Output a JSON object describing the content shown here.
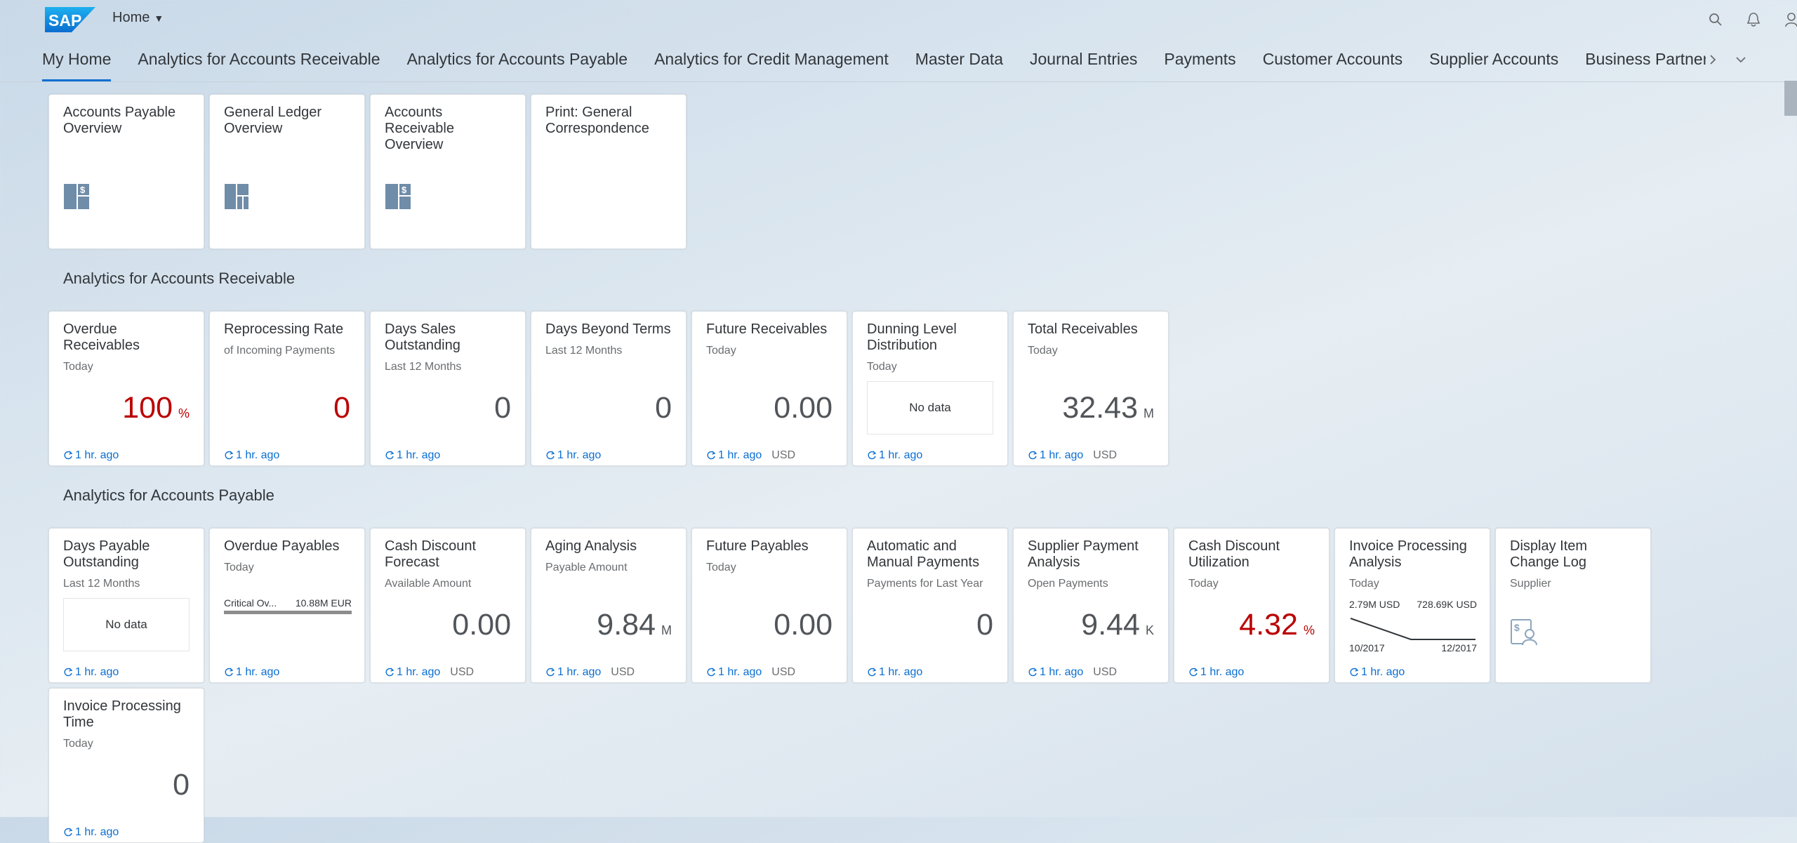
{
  "shell": {
    "logo_text": "SAP",
    "home_label": "Home",
    "brand_color": "#0a6ed1",
    "icons": [
      "search-icon",
      "bell-icon",
      "user-icon"
    ]
  },
  "tabs": [
    {
      "label": "My Home",
      "active": true
    },
    {
      "label": "Analytics for Accounts Receivable"
    },
    {
      "label": "Analytics for Accounts Payable"
    },
    {
      "label": "Analytics for Credit Management"
    },
    {
      "label": "Master Data"
    },
    {
      "label": "Journal Entries"
    },
    {
      "label": "Payments"
    },
    {
      "label": "Customer Accounts"
    },
    {
      "label": "Supplier Accounts"
    },
    {
      "label": "Business Partner Ma"
    }
  ],
  "my_home": {
    "tiles": [
      {
        "title": "Accounts Payable Overview",
        "icon": "overview-page-icon"
      },
      {
        "title": "General Ledger Overview",
        "icon": "overview-page-icon"
      },
      {
        "title": "Accounts Receivable Overview",
        "icon": "overview-page-icon"
      },
      {
        "title": "Print: General Correspondence"
      }
    ]
  },
  "ar": {
    "title": "Analytics for Accounts Receivable",
    "tiles": [
      {
        "title": "Overdue Receivables",
        "sub": "Today",
        "value": "100",
        "scale": "%",
        "refresh": "1 hr. ago",
        "unit": ""
      },
      {
        "title": "Reprocessing Rate",
        "sub": "of Incoming Payments",
        "value": "0",
        "scale": "",
        "refresh": "1 hr. ago",
        "unit": ""
      },
      {
        "title": "Days Sales Outstanding",
        "sub": "Last 12 Months",
        "value": "0",
        "scale": "",
        "refresh": "1 hr. ago",
        "unit": ""
      },
      {
        "title": "Days Beyond Terms",
        "sub": "Last 12 Months",
        "value": "0",
        "scale": "",
        "refresh": "1 hr. ago",
        "unit": ""
      },
      {
        "title": "Future Receivables",
        "sub": "Today",
        "value": "0.00",
        "scale": "",
        "refresh": "1 hr. ago",
        "unit": "USD"
      },
      {
        "title": "Dunning Level Distribution",
        "sub": "Today",
        "nodata": "No data",
        "refresh": "1 hr. ago",
        "unit": ""
      },
      {
        "title": "Total Receivables",
        "sub": "Today",
        "value": "32.43",
        "scale": "M",
        "refresh": "1 hr. ago",
        "unit": "USD"
      }
    ]
  },
  "ap": {
    "title": "Analytics for Accounts Payable",
    "tiles": [
      {
        "title": "Days Payable Outstanding",
        "sub": "Last 12 Months",
        "nodata": "No data",
        "refresh": "1 hr. ago",
        "unit": ""
      },
      {
        "title": "Overdue Payables",
        "sub": "Today",
        "bullet_label": "Critical Ov...",
        "bullet_value": "10.88M EUR",
        "refresh": "1 hr. ago",
        "unit": ""
      },
      {
        "title": "Cash Discount Forecast",
        "sub": "Available Amount",
        "value": "0.00",
        "scale": "",
        "refresh": "1 hr. ago",
        "unit": "USD"
      },
      {
        "title": "Aging Analysis",
        "sub": "Payable Amount",
        "value": "9.84",
        "scale": "M",
        "refresh": "1 hr. ago",
        "unit": "USD"
      },
      {
        "title": "Future Payables",
        "sub": "Today",
        "value": "0.00",
        "scale": "",
        "refresh": "1 hr. ago",
        "unit": "USD"
      },
      {
        "title": "Automatic and Manual Payments",
        "sub": "Payments for Last Year",
        "value": "0",
        "scale": "",
        "refresh": "1 hr. ago",
        "unit": ""
      },
      {
        "title": "Supplier Payment Analysis",
        "sub": "Open Payments",
        "value": "9.44",
        "scale": "K",
        "refresh": "1 hr. ago",
        "unit": "USD"
      },
      {
        "title": "Cash Discount Utilization",
        "sub": "Today",
        "value": "4.32",
        "scale": "%",
        "refresh": "1 hr. ago",
        "unit": ""
      },
      {
        "title": "Invoice Processing Analysis",
        "sub": "Today",
        "spark": {
          "left_value": "2.79M USD",
          "right_value": "728.69K USD",
          "left_date": "10/2017",
          "right_date": "12/2017"
        },
        "refresh": "1 hr. ago",
        "unit": ""
      },
      {
        "title": "Display Item Change Log",
        "sub": "Supplier",
        "icon": "supplier-icon"
      },
      {
        "title": "Invoice Processing Time",
        "sub": "Today",
        "value": "0",
        "scale": "",
        "refresh": "1 hr. ago",
        "unit": ""
      }
    ]
  },
  "colors": {
    "critical": "#bb0000",
    "link": "#0a6ed1"
  }
}
